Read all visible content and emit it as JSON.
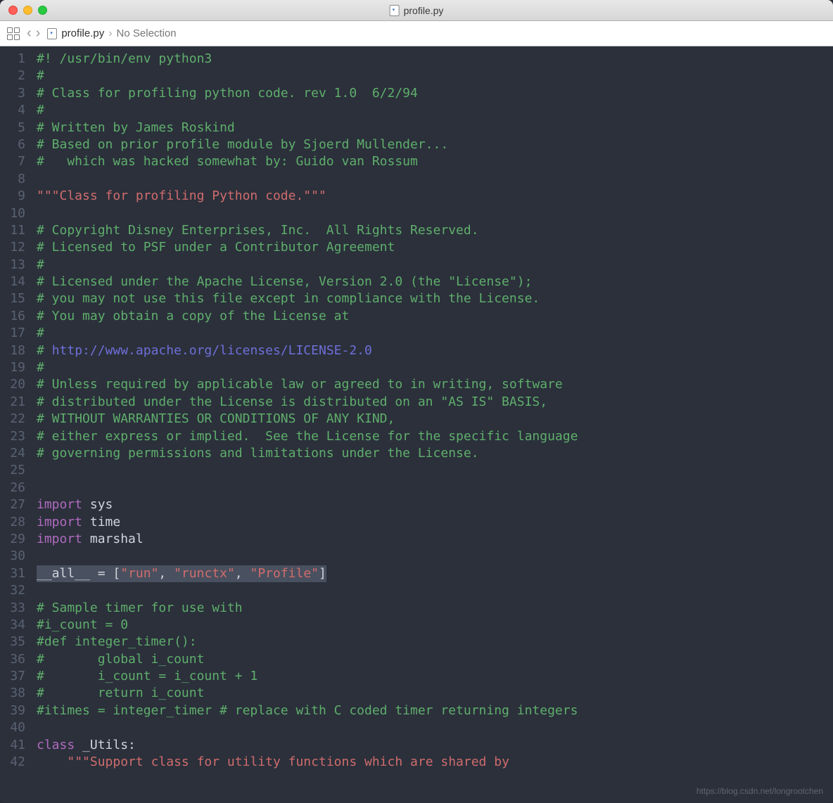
{
  "title": "profile.py",
  "breadcrumb": {
    "file": "profile.py",
    "selection": "No Selection"
  },
  "watermark": "https://blog.csdn.net/longrootchen",
  "code": {
    "lines": [
      {
        "n": 1,
        "seg": [
          {
            "c": "cm",
            "t": "#! /usr/bin/env python3"
          }
        ]
      },
      {
        "n": 2,
        "seg": [
          {
            "c": "cm",
            "t": "#"
          }
        ]
      },
      {
        "n": 3,
        "seg": [
          {
            "c": "cm",
            "t": "# Class for profiling python code. rev 1.0  6/2/94"
          }
        ]
      },
      {
        "n": 4,
        "seg": [
          {
            "c": "cm",
            "t": "#"
          }
        ]
      },
      {
        "n": 5,
        "seg": [
          {
            "c": "cm",
            "t": "# Written by James Roskind"
          }
        ]
      },
      {
        "n": 6,
        "seg": [
          {
            "c": "cm",
            "t": "# Based on prior profile module by Sjoerd Mullender..."
          }
        ]
      },
      {
        "n": 7,
        "seg": [
          {
            "c": "cm",
            "t": "#   which was hacked somewhat by: Guido van Rossum"
          }
        ]
      },
      {
        "n": 8,
        "seg": []
      },
      {
        "n": 9,
        "seg": [
          {
            "c": "str",
            "t": "\"\"\"Class for profiling Python code.\"\"\""
          }
        ]
      },
      {
        "n": 10,
        "seg": []
      },
      {
        "n": 11,
        "seg": [
          {
            "c": "cm",
            "t": "# Copyright Disney Enterprises, Inc.  All Rights Reserved."
          }
        ]
      },
      {
        "n": 12,
        "seg": [
          {
            "c": "cm",
            "t": "# Licensed to PSF under a Contributor Agreement"
          }
        ]
      },
      {
        "n": 13,
        "seg": [
          {
            "c": "cm",
            "t": "#"
          }
        ]
      },
      {
        "n": 14,
        "seg": [
          {
            "c": "cm",
            "t": "# Licensed under the Apache License, Version 2.0 (the \"License\");"
          }
        ]
      },
      {
        "n": 15,
        "seg": [
          {
            "c": "cm",
            "t": "# you may not use this file except in compliance with the License."
          }
        ]
      },
      {
        "n": 16,
        "seg": [
          {
            "c": "cm",
            "t": "# You may obtain a copy of the License at"
          }
        ]
      },
      {
        "n": 17,
        "seg": [
          {
            "c": "cm",
            "t": "#"
          }
        ]
      },
      {
        "n": 18,
        "seg": [
          {
            "c": "cm",
            "t": "# "
          },
          {
            "c": "url",
            "t": "http://www.apache.org/licenses/LICENSE-2.0"
          }
        ]
      },
      {
        "n": 19,
        "seg": [
          {
            "c": "cm",
            "t": "#"
          }
        ]
      },
      {
        "n": 20,
        "seg": [
          {
            "c": "cm",
            "t": "# Unless required by applicable law or agreed to in writing, software"
          }
        ]
      },
      {
        "n": 21,
        "seg": [
          {
            "c": "cm",
            "t": "# distributed under the License is distributed on an \"AS IS\" BASIS,"
          }
        ]
      },
      {
        "n": 22,
        "seg": [
          {
            "c": "cm",
            "t": "# WITHOUT WARRANTIES OR CONDITIONS OF ANY KIND,"
          }
        ]
      },
      {
        "n": 23,
        "seg": [
          {
            "c": "cm",
            "t": "# either express or implied.  See the License for the specific language"
          }
        ]
      },
      {
        "n": 24,
        "seg": [
          {
            "c": "cm",
            "t": "# governing permissions and limitations under the License."
          }
        ]
      },
      {
        "n": 25,
        "seg": []
      },
      {
        "n": 26,
        "seg": []
      },
      {
        "n": 27,
        "seg": [
          {
            "c": "kw",
            "t": "import"
          },
          {
            "c": "id",
            "t": " sys"
          }
        ]
      },
      {
        "n": 28,
        "seg": [
          {
            "c": "kw",
            "t": "import"
          },
          {
            "c": "id",
            "t": " time"
          }
        ]
      },
      {
        "n": 29,
        "seg": [
          {
            "c": "kw",
            "t": "import"
          },
          {
            "c": "id",
            "t": " marshal"
          }
        ]
      },
      {
        "n": 30,
        "seg": []
      },
      {
        "n": 31,
        "hl": true,
        "seg": [
          {
            "c": "id",
            "t": "__all__ = ["
          },
          {
            "c": "str",
            "t": "\"run\""
          },
          {
            "c": "id",
            "t": ", "
          },
          {
            "c": "str",
            "t": "\"runctx\""
          },
          {
            "c": "id",
            "t": ", "
          },
          {
            "c": "str",
            "t": "\"Profile\""
          },
          {
            "c": "id",
            "t": "]"
          }
        ]
      },
      {
        "n": 32,
        "seg": []
      },
      {
        "n": 33,
        "seg": [
          {
            "c": "cm",
            "t": "# Sample timer for use with"
          }
        ]
      },
      {
        "n": 34,
        "seg": [
          {
            "c": "cm",
            "t": "#i_count = 0"
          }
        ]
      },
      {
        "n": 35,
        "seg": [
          {
            "c": "cm",
            "t": "#def integer_timer():"
          }
        ]
      },
      {
        "n": 36,
        "seg": [
          {
            "c": "cm",
            "t": "#       global i_count"
          }
        ]
      },
      {
        "n": 37,
        "seg": [
          {
            "c": "cm",
            "t": "#       i_count = i_count + 1"
          }
        ]
      },
      {
        "n": 38,
        "seg": [
          {
            "c": "cm",
            "t": "#       return i_count"
          }
        ]
      },
      {
        "n": 39,
        "seg": [
          {
            "c": "cm",
            "t": "#itimes = integer_timer # replace with C coded timer returning integers"
          }
        ]
      },
      {
        "n": 40,
        "seg": []
      },
      {
        "n": 41,
        "seg": [
          {
            "c": "kw",
            "t": "class"
          },
          {
            "c": "id",
            "t": " _Utils:"
          }
        ]
      },
      {
        "n": 42,
        "seg": [
          {
            "c": "id",
            "t": "    "
          },
          {
            "c": "str",
            "t": "\"\"\"Support class for utility functions which are shared by"
          }
        ]
      }
    ]
  }
}
